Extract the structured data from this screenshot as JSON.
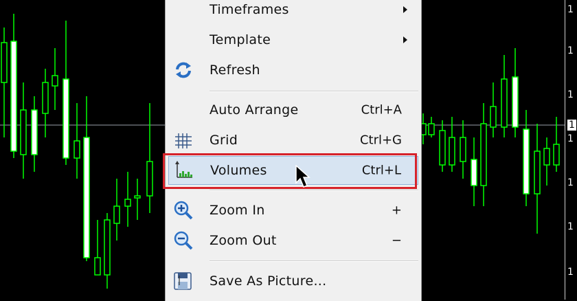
{
  "price_axis": {
    "labels": [
      "1",
      "1",
      "1",
      "1",
      "1",
      "1",
      "1",
      "1"
    ],
    "current_label": "1"
  },
  "context_menu": {
    "items": [
      {
        "label": "Timeframes",
        "shortcut": "",
        "has_submenu": true,
        "icon": ""
      },
      {
        "label": "Template",
        "shortcut": "",
        "has_submenu": true,
        "icon": ""
      },
      {
        "label": "Refresh",
        "shortcut": "",
        "has_submenu": false,
        "icon": "refresh-icon"
      },
      {
        "label": "Auto Arrange",
        "shortcut": "Ctrl+A",
        "has_submenu": false,
        "icon": ""
      },
      {
        "label": "Grid",
        "shortcut": "Ctrl+G",
        "has_submenu": false,
        "icon": "grid-icon"
      },
      {
        "label": "Volumes",
        "shortcut": "Ctrl+L",
        "has_submenu": false,
        "icon": "volumes-icon",
        "highlighted": true
      },
      {
        "label": "Zoom In",
        "shortcut": "+",
        "has_submenu": false,
        "icon": "zoom-in-icon"
      },
      {
        "label": "Zoom Out",
        "shortcut": "−",
        "has_submenu": false,
        "icon": "zoom-out-icon"
      },
      {
        "label": "Save As Picture...",
        "shortcut": "",
        "has_submenu": false,
        "icon": "save-picture-icon"
      }
    ]
  },
  "colors": {
    "chart_background": "#000000",
    "candle_color": "#00ff00",
    "menu_background": "#f0f0f0",
    "highlight_background": "#d7e4f2",
    "annotation_border": "#d6222a"
  }
}
